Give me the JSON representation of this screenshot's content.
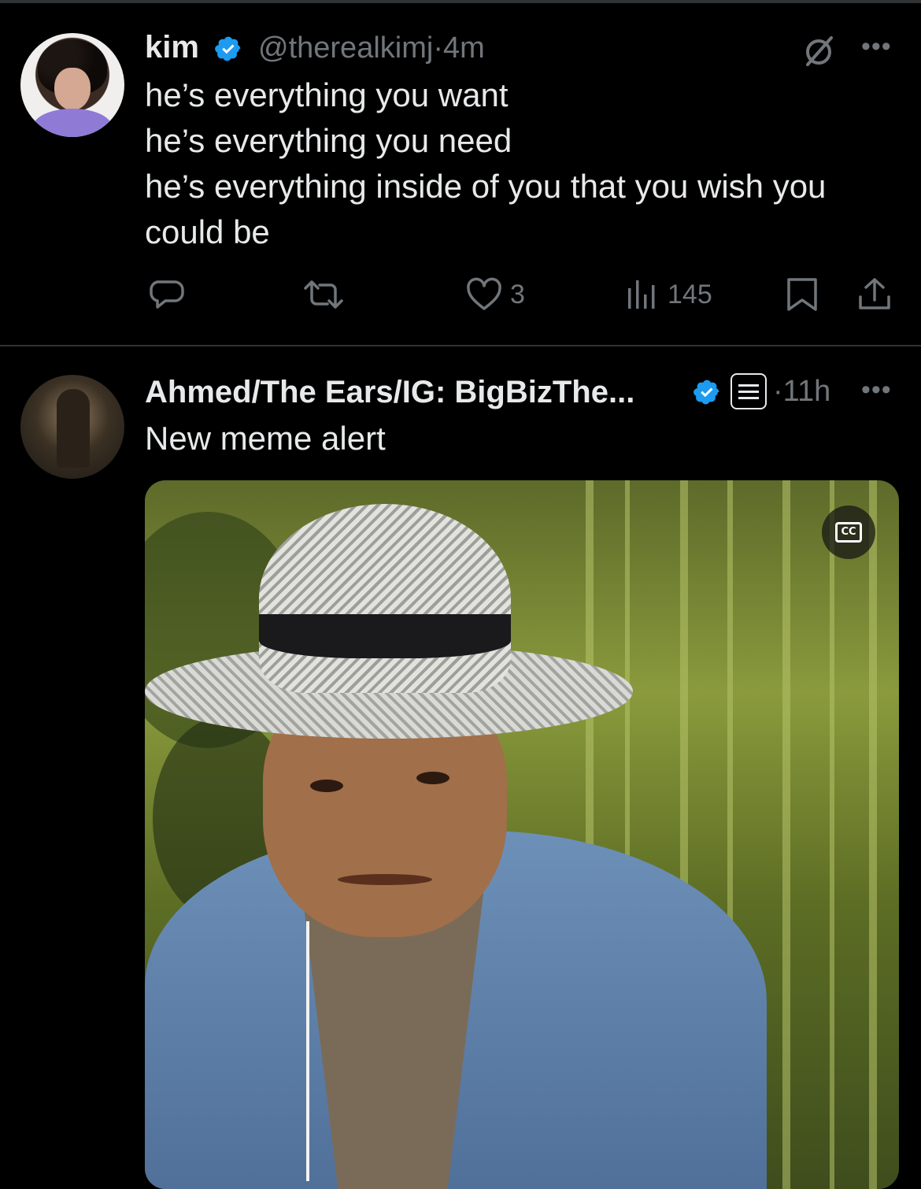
{
  "tweets": [
    {
      "display_name": "kim",
      "handle": "@therealkimj",
      "time": "4m",
      "text": "he’s everything you want\nhe’s everything you need\nhe’s everything inside of you that you wish you could be",
      "actions": {
        "reply_count": "",
        "retweet_count": "",
        "like_count": "3",
        "view_count": "145"
      },
      "icons": [
        "reply-icon",
        "retweet-icon",
        "like-icon",
        "views-icon",
        "bookmark-icon",
        "share-icon",
        "grok-icon",
        "more-icon",
        "verified-icon"
      ]
    },
    {
      "display_name": "Ahmed/The Ears/IG: BigBizThe...",
      "time": "11h",
      "text": "New meme alert",
      "media": {
        "type": "video",
        "cc_label": "CC"
      },
      "icons": [
        "verified-icon",
        "affiliate-badge-icon",
        "more-icon",
        "cc-icon"
      ]
    }
  ],
  "colors": {
    "background": "#000000",
    "text": "#e7e9ea",
    "secondary": "#71767b",
    "verified": "#1d9bf0",
    "divider": "#2f3336"
  },
  "separator": "·"
}
